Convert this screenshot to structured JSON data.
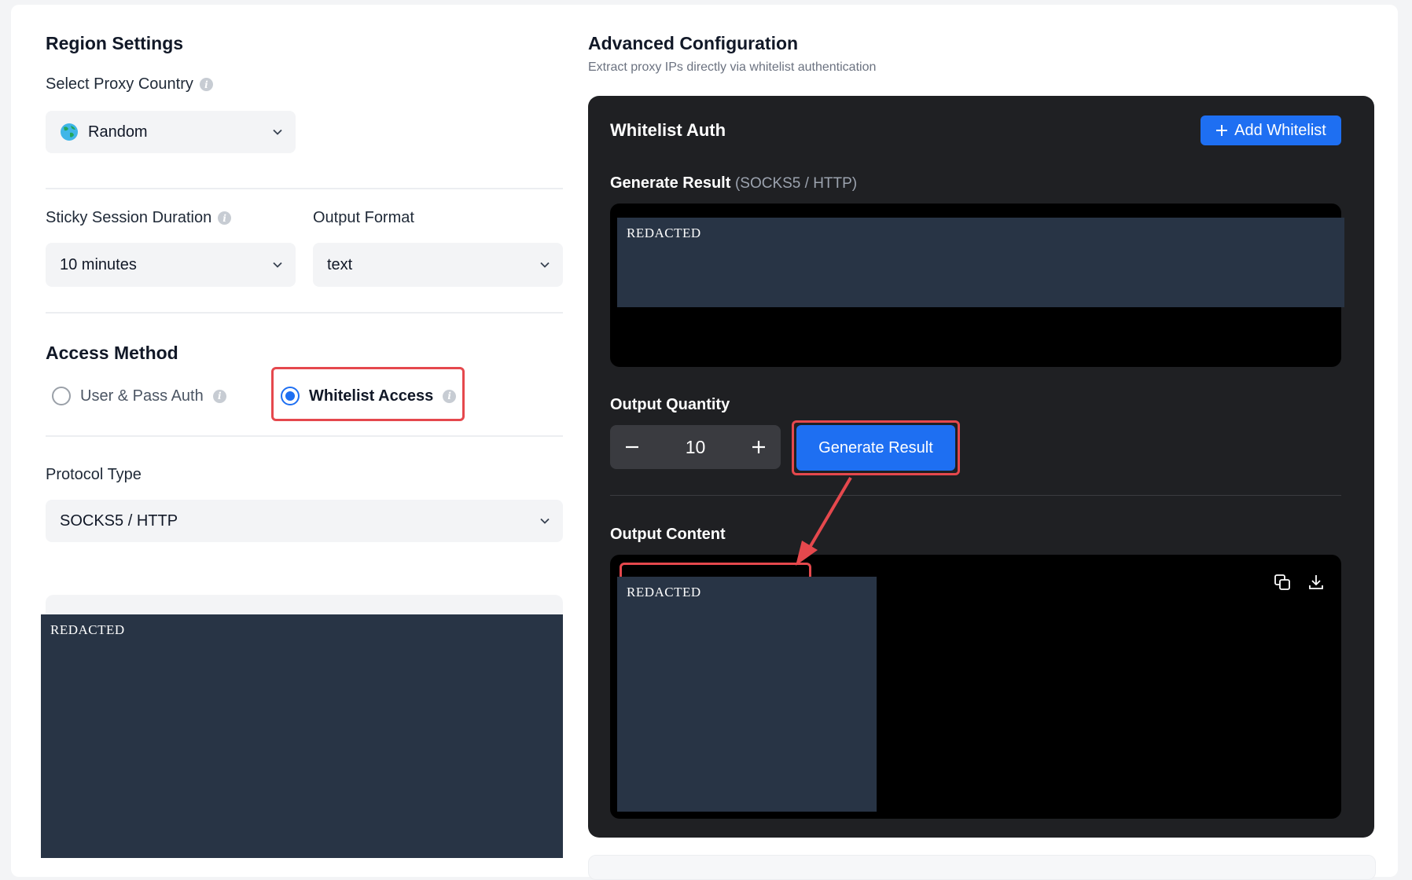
{
  "region": {
    "title": "Region Settings",
    "country_label": "Select Proxy Country",
    "country_value": "Random",
    "sticky_label": "Sticky Session Duration",
    "sticky_value": "10 minutes",
    "format_label": "Output Format",
    "format_value": "text"
  },
  "access": {
    "title": "Access Method",
    "option_userpass": "User & Pass Auth",
    "option_whitelist": "Whitelist Access",
    "selected": "Whitelist Access"
  },
  "protocol": {
    "label": "Protocol Type",
    "value": "SOCKS5 / HTTP"
  },
  "left_preview": {
    "text": "REDACTED"
  },
  "advanced": {
    "title": "Advanced Configuration",
    "subtitle": "Extract proxy IPs directly via whitelist authentication"
  },
  "whitelist": {
    "title": "Whitelist Auth",
    "add_button": "Add Whitelist",
    "generate_label": "Generate Result",
    "generate_suffix": "(SOCKS5 / HTTP)",
    "generate_text": "REDACTED",
    "quantity_label": "Output Quantity",
    "quantity_value": "10",
    "generate_button": "Generate Result",
    "output_label": "Output Content",
    "output_text": "REDACTED"
  },
  "colors": {
    "accent": "#1e6ff2",
    "highlight": "#e5484d",
    "panel_dark": "#1f2023",
    "redacted_bg": "#283445"
  },
  "icons": [
    "info-icon",
    "globe-icon",
    "chevron-down-icon",
    "plus-icon",
    "minus-icon",
    "copy-icon",
    "download-icon"
  ]
}
